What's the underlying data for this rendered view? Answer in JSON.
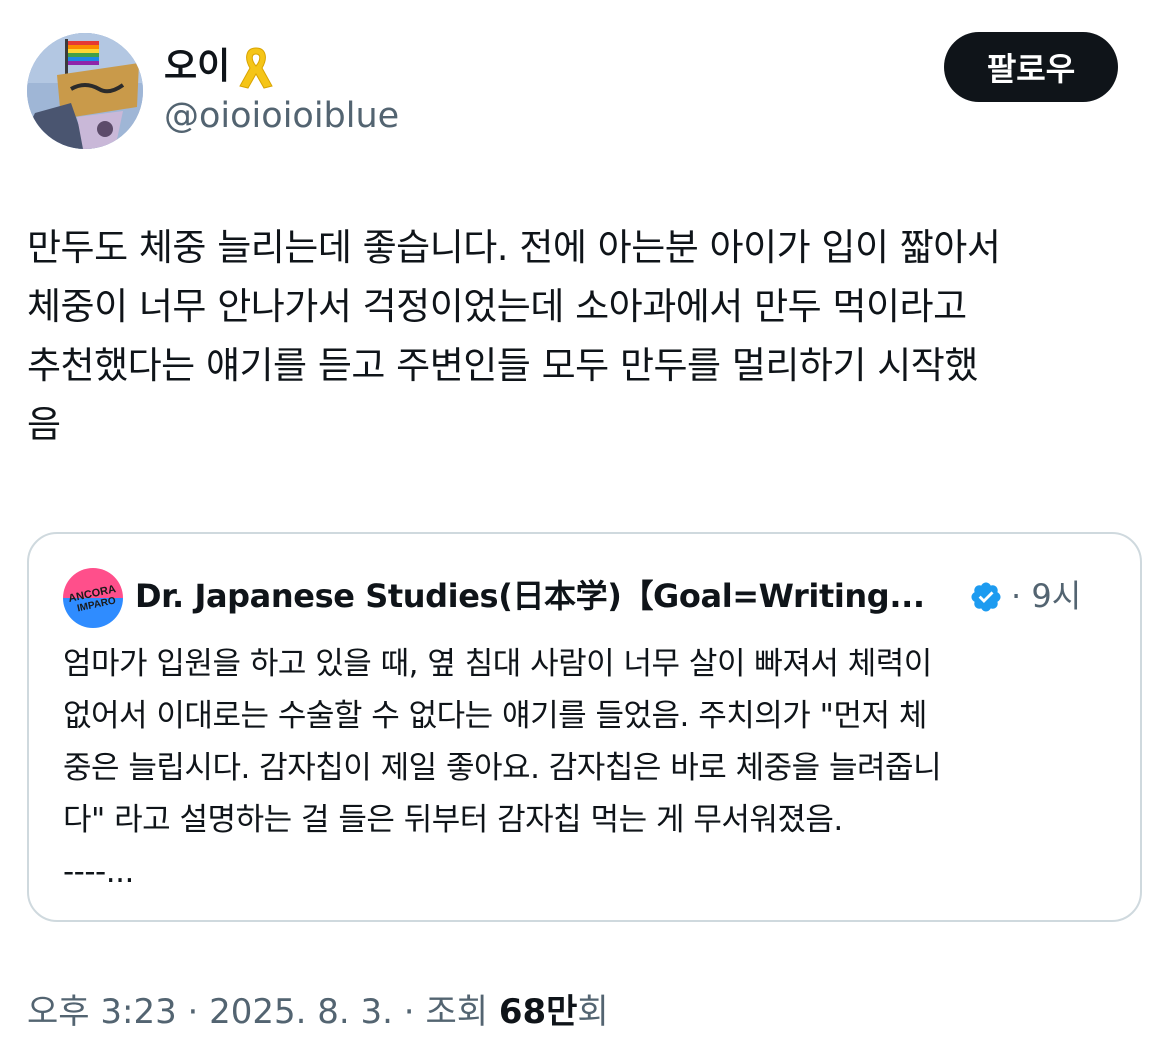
{
  "author": {
    "display_name": "오이",
    "handle": "@oioioioiblue",
    "follow_label": "팔로우",
    "ribbon_icon": "yellow-ribbon-icon"
  },
  "tweet": {
    "lines": [
      "만두도 체중 늘리는데 좋습니다. 전에 아는분 아이가 입이 짧아서",
      "체중이 너무 안나가서 걱정이었는데 소아과에서 만두 먹이라고",
      "추천했다는 얘기를 듣고 주변인들 모두 만두를 멀리하기 시작했",
      "음"
    ]
  },
  "quote": {
    "avatar_text_1": "ANCORA",
    "avatar_text_2": "IMPARO",
    "author_name": "Dr. Japanese Studies(日本学)【Goal=Writing...",
    "verified_icon": "verified-badge-icon",
    "time": "· 9시",
    "lines": [
      "엄마가 입원을 하고 있을 때, 옆 침대 사람이 너무 살이 빠져서 체력이",
      "없어서 이대로는 수술할 수 없다는 얘기를 들었음. 주치의가 \"먼저 체",
      "중은 늘립시다. 감자칩이 제일 좋아요. 감자칩은 바로 체중을 늘려줍니",
      "다\" 라고 설명하는 걸 들은 뒤부터 감자칩 먹는 게 무서워졌음.",
      "----..."
    ]
  },
  "meta": {
    "time": "오후 3:23",
    "sep1": " · ",
    "date": "2025. 8. 3.",
    "sep2": " · ",
    "views_label": "조회 ",
    "views_number": "68",
    "views_unit": "만",
    "views_suffix": "회"
  },
  "colors": {
    "text": "#0f1419",
    "secondary": "#536471",
    "border": "#cfd9de",
    "verified": "#1d9bf0",
    "ribbon": "#f5c518"
  }
}
